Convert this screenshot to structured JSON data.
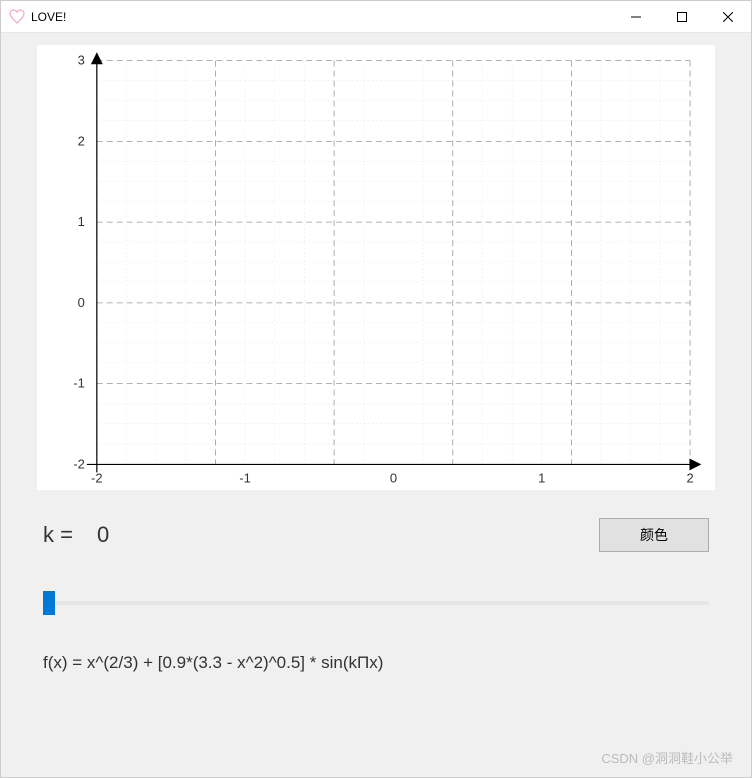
{
  "window": {
    "title": "LOVE!"
  },
  "chart_data": {
    "type": "line",
    "x_ticks": [
      -2,
      -1,
      0,
      1,
      2
    ],
    "y_ticks": [
      -2,
      -1,
      0,
      1,
      2,
      3
    ],
    "xlim": [
      -2.3,
      2.3
    ],
    "ylim": [
      -2.2,
      3.2
    ],
    "grid": true,
    "series": []
  },
  "controls": {
    "k_label": "k =",
    "k_value": "0",
    "color_button": "颜色",
    "slider_value": 0,
    "slider_min": 0,
    "slider_max": 100
  },
  "formula": "f(x) = x^(2/3) + [0.9*(3.3 - x^2)^0.5] * sin(kΠx)",
  "watermark": "CSDN @洞洞鞋小公举"
}
